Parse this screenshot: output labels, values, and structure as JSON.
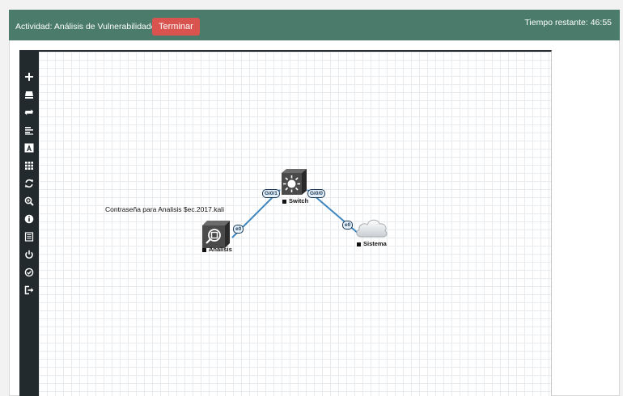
{
  "header": {
    "activity_title": "Actividad: Análisis de Vulnerabilidades",
    "end_button_label": "Terminar",
    "timer_text": "Tiempo restante: 46:55",
    "color": "#4a7b6b",
    "button_color": "#d9534f"
  },
  "sidebar": {
    "icons": [
      "add-icon",
      "device-icon",
      "connect-icon",
      "list-icon",
      "text-icon",
      "grid-icon",
      "refresh-icon",
      "zoom-icon",
      "info-icon",
      "document-icon",
      "power-icon",
      "check-circle-icon",
      "logout-icon"
    ]
  },
  "topology": {
    "note": "Contraseña para Analisis $ec.2017.kali",
    "nodes": {
      "switch": {
        "label": "Switch"
      },
      "analisis": {
        "label": "Analisis"
      },
      "sistema": {
        "label": "Sistema"
      }
    },
    "ports": {
      "switch_gi01": "Gi0/1",
      "switch_gi00": "Gi0/0",
      "analisis_e0": "e0",
      "sistema_e0": "e0"
    },
    "link_color": "#3f86bf"
  }
}
